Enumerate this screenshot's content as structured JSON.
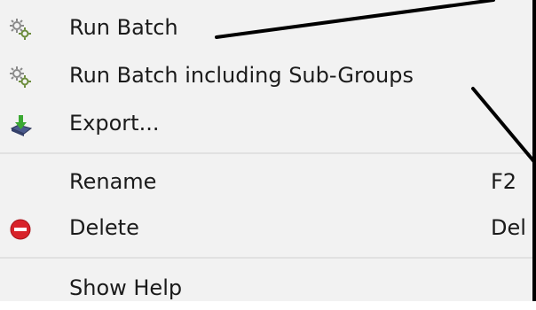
{
  "context_menu": {
    "items": [
      {
        "label": "Run Batch",
        "icon": "gears-icon"
      },
      {
        "label": "Run Batch including Sub-Groups",
        "icon": "gears-icon"
      },
      {
        "label": "Export...",
        "icon": "export-icon"
      }
    ],
    "edit_items": [
      {
        "label": "Rename",
        "shortcut": "F2"
      },
      {
        "label": "Delete",
        "shortcut": "Del",
        "icon": "delete-icon"
      }
    ],
    "help_items": [
      {
        "label": "Show Help"
      }
    ]
  },
  "colors": {
    "menu_background": "#f2f2f2",
    "separator": "#e1e1e1",
    "delete_icon_red": "#d8232a",
    "export_arrow_green": "#3aa832",
    "annotation_line": "#000000"
  }
}
